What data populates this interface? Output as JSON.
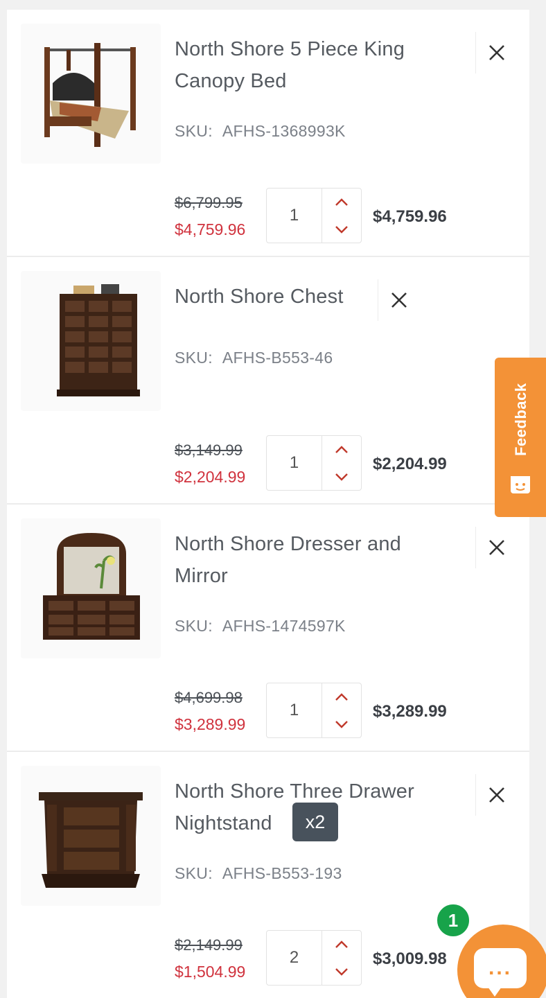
{
  "cart_items": [
    {
      "title": "North Shore 5 Piece King Canopy Bed",
      "sku_label": "SKU:",
      "sku": "AFHS-1368993K",
      "old_price": "$6,799.95",
      "sale_price": "$4,759.96",
      "quantity": "1",
      "line_total": "$4,759.96"
    },
    {
      "title": "North Shore Chest",
      "sku_label": "SKU:",
      "sku": "AFHS-B553-46",
      "old_price": "$3,149.99",
      "sale_price": "$2,204.99",
      "quantity": "1",
      "line_total": "$2,204.99"
    },
    {
      "title": "North Shore Dresser and Mirror",
      "sku_label": "SKU:",
      "sku": "AFHS-1474597K",
      "old_price": "$4,699.98",
      "sale_price": "$3,289.99",
      "quantity": "1",
      "line_total": "$3,289.99"
    },
    {
      "title": "North Shore Three Drawer Nightstand",
      "sku_label": "SKU:",
      "sku": "AFHS-B553-193",
      "old_price": "$2,149.99",
      "sale_price": "$1,504.99",
      "quantity": "2",
      "line_total": "$3,009.98",
      "multiplier_badge": "x2"
    }
  ],
  "feedback_tab": {
    "label": "Feedback",
    "color": "#f39237"
  },
  "chat": {
    "bubble_text": "...",
    "notification_count": "1",
    "badge_color": "#17a34a"
  },
  "colors": {
    "sale_price": "#d0323d",
    "accent": "#f39237",
    "arrow": "#c0392b"
  },
  "icons": {
    "remove": "close-icon",
    "increment": "chevron-up-icon",
    "decrement": "chevron-down-icon",
    "feedback": "smiley-icon",
    "chat": "chat-bubble-icon"
  }
}
